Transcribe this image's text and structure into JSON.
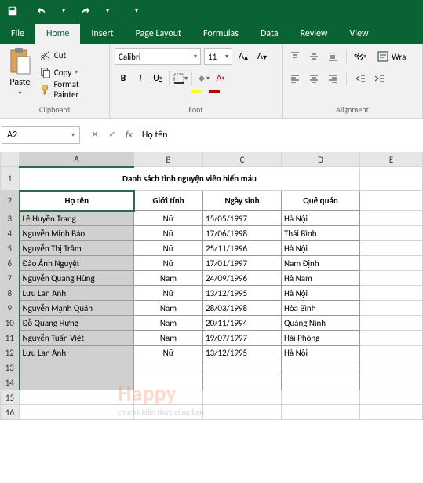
{
  "tabs": {
    "file": "File",
    "home": "Home",
    "insert": "Insert",
    "pagelayout": "Page Layout",
    "formulas": "Formulas",
    "data": "Data",
    "review": "Review",
    "view": "View"
  },
  "ribbon": {
    "paste": "Paste",
    "cut": "Cut",
    "copy": "Copy",
    "format_painter": "Format Painter",
    "clipboard_label": "Clipboard",
    "font_name": "Calibri",
    "font_size": "11",
    "font_label": "Font",
    "wrap": "Wra",
    "alignment_label": "Alignment"
  },
  "formula_bar": {
    "name_box": "A2",
    "fx": "fx",
    "value": "Họ tên"
  },
  "columns": {
    "A": "A",
    "B": "B",
    "C": "C",
    "D": "D",
    "E": "E"
  },
  "rows": [
    "1",
    "2",
    "3",
    "4",
    "5",
    "6",
    "7",
    "8",
    "9",
    "10",
    "11",
    "12",
    "13",
    "14",
    "15",
    "16"
  ],
  "title": "Danh sách tình nguyện viên hiến máu",
  "headers": {
    "name": "Họ tên",
    "gender": "Giới tính",
    "dob": "Ngày sinh",
    "hometown": "Quê quán"
  },
  "data": [
    {
      "name": "Lê Huyền Trang",
      "gender": "Nữ",
      "dob": "15/05/1997",
      "hometown": "Hà Nội"
    },
    {
      "name": "Nguyễn Minh Bảo",
      "gender": "Nữ",
      "dob": "17/06/1998",
      "hometown": "Thái Bình"
    },
    {
      "name": "Nguyễn Thị Trâm",
      "gender": "Nữ",
      "dob": "25/11/1996",
      "hometown": "Hà Nội"
    },
    {
      "name": "Đào Ánh Nguyệt",
      "gender": "Nữ",
      "dob": "17/01/1997",
      "hometown": "Nam Định"
    },
    {
      "name": "Nguyễn Quang Hùng",
      "gender": "Nam",
      "dob": "24/09/1996",
      "hometown": "Hà Nam"
    },
    {
      "name": "Lưu Lan Anh",
      "gender": "Nữ",
      "dob": "13/12/1995",
      "hometown": "Hà Nội"
    },
    {
      "name": "Nguyễn Mạnh Quân",
      "gender": "Nam",
      "dob": "28/03/1998",
      "hometown": "Hòa Bình"
    },
    {
      "name": "Đỗ Quang Hưng",
      "gender": "Nam",
      "dob": "20/11/1994",
      "hometown": "Quảng Ninh"
    },
    {
      "name": "Nguyễn Tuấn Việt",
      "gender": "Nam",
      "dob": "19/07/1997",
      "hometown": "Hải Phòng"
    },
    {
      "name": "Lưu Lan Anh",
      "gender": "Nữ",
      "dob": "13/12/1995",
      "hometown": "Hà Nội"
    }
  ],
  "watermark": {
    "main": "Happy",
    "sub": "chia sẻ kiến thức cùng bạn"
  }
}
